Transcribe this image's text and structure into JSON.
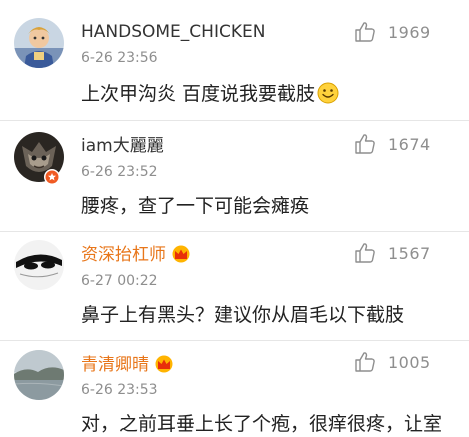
{
  "comments": [
    {
      "username": "HANDSOME_CHICKEN",
      "time": "6-26 23:56",
      "likes": "1969",
      "text": "上次甲沟炎 百度说我要截肢"
    },
    {
      "username": "iam大麗麗",
      "time": "6-26 23:52",
      "likes": "1674",
      "text": "腰疼，查了一下可能会瘫痪"
    },
    {
      "username": "资深抬杠师",
      "time": "6-27 00:22",
      "likes": "1567",
      "text": "鼻子上有黑头？建议你从眉毛以下截肢"
    },
    {
      "username": "青清卿晴",
      "time": "6-26 23:53",
      "likes": "1005",
      "text": "对，之前耳垂上长了个疱，很痒很疼，让室"
    }
  ],
  "colors": {
    "vip_name": "#e8761a",
    "meta_gray": "#8e8e8e",
    "text": "#222222",
    "verified_badge": "#f05a23"
  },
  "icons": {
    "like": "thumbs-up-icon",
    "crown": "vip-crown-icon",
    "emoji": "smile-emoji-icon",
    "verified": "verified-badge-icon"
  }
}
